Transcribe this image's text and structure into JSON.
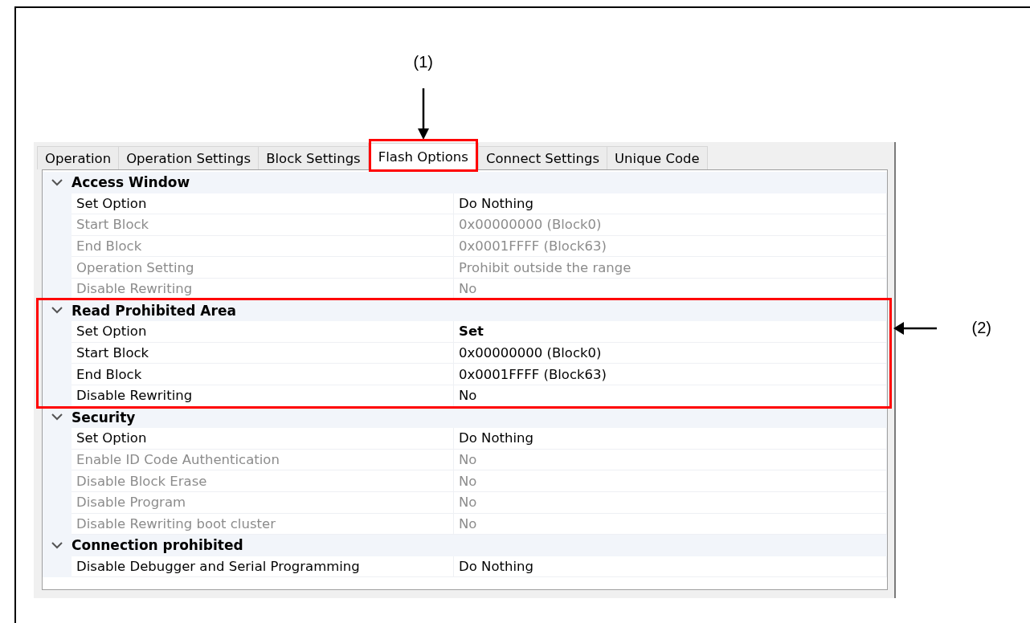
{
  "tabs": [
    {
      "label": "Operation",
      "selected": false,
      "highlighted": false
    },
    {
      "label": "Operation Settings",
      "selected": false,
      "highlighted": false
    },
    {
      "label": "Block Settings",
      "selected": false,
      "highlighted": false
    },
    {
      "label": "Flash Options",
      "selected": true,
      "highlighted": true,
      "callout": "(1)"
    },
    {
      "label": "Connect Settings",
      "selected": false,
      "highlighted": false
    },
    {
      "label": "Unique Code",
      "selected": false,
      "highlighted": false
    }
  ],
  "sections": [
    {
      "title": "Access Window",
      "expanded": true,
      "highlighted": false,
      "rows": [
        {
          "label": "Set Option",
          "value": "Do Nothing",
          "disabled": false,
          "bold": false
        },
        {
          "label": "Start Block",
          "value": "0x00000000 (Block0)",
          "disabled": true,
          "bold": false
        },
        {
          "label": "End Block",
          "value": "0x0001FFFF (Block63)",
          "disabled": true,
          "bold": false
        },
        {
          "label": "Operation Setting",
          "value": "Prohibit outside the range",
          "disabled": true,
          "bold": false
        },
        {
          "label": "Disable Rewriting",
          "value": "No",
          "disabled": true,
          "bold": false
        }
      ]
    },
    {
      "title": "Read Prohibited Area",
      "expanded": true,
      "highlighted": true,
      "callout": "(2)",
      "rows": [
        {
          "label": "Set Option",
          "value": "Set",
          "disabled": false,
          "bold": true
        },
        {
          "label": "Start Block",
          "value": "0x00000000 (Block0)",
          "disabled": false,
          "bold": false
        },
        {
          "label": "End Block",
          "value": "0x0001FFFF (Block63)",
          "disabled": false,
          "bold": false
        },
        {
          "label": "Disable Rewriting",
          "value": "No",
          "disabled": false,
          "bold": false
        }
      ]
    },
    {
      "title": "Security",
      "expanded": true,
      "highlighted": false,
      "rows": [
        {
          "label": "Set Option",
          "value": "Do Nothing",
          "disabled": false,
          "bold": false
        },
        {
          "label": "Enable ID Code Authentication",
          "value": "No",
          "disabled": true,
          "bold": false
        },
        {
          "label": "Disable Block Erase",
          "value": "No",
          "disabled": true,
          "bold": false
        },
        {
          "label": "Disable Program",
          "value": "No",
          "disabled": true,
          "bold": false
        },
        {
          "label": "Disable Rewriting boot cluster",
          "value": "No",
          "disabled": true,
          "bold": false
        }
      ]
    },
    {
      "title": "Connection prohibited",
      "expanded": true,
      "highlighted": false,
      "rows": [
        {
          "label": "Disable Debugger and Serial Programming",
          "value": "Do Nothing",
          "disabled": false,
          "bold": false
        }
      ]
    }
  ]
}
